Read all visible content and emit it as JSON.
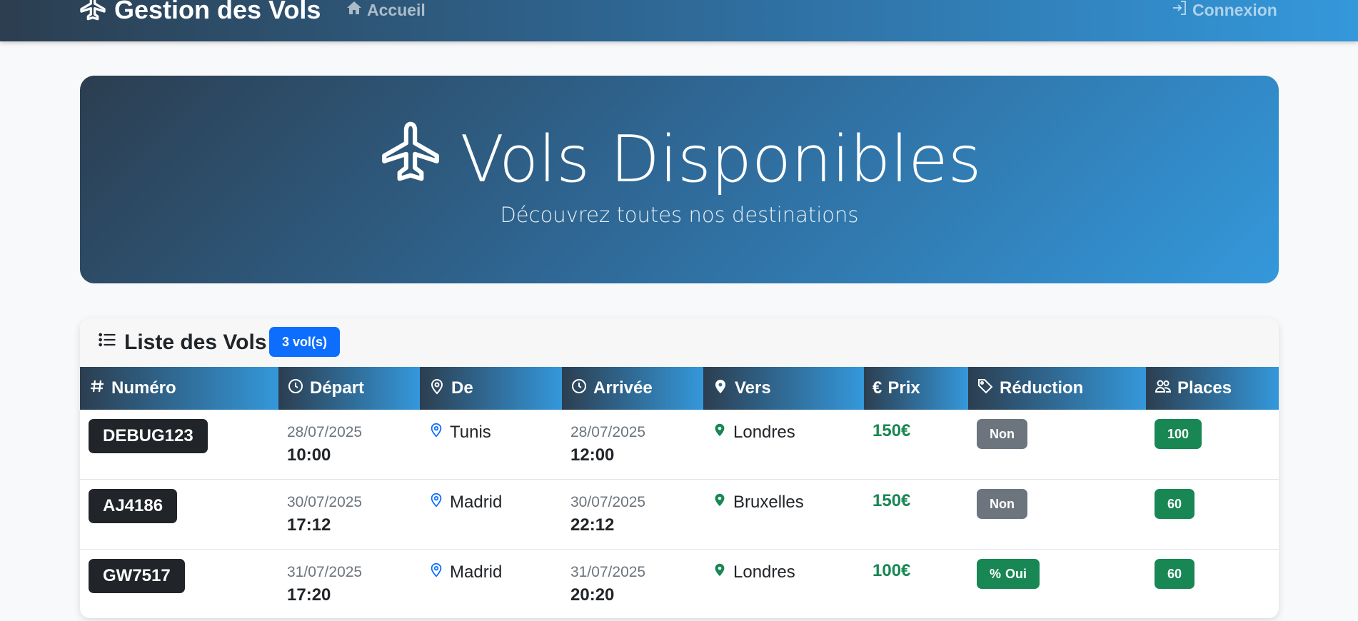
{
  "navbar": {
    "brand": "Gestion des Vols",
    "home_label": "Accueil",
    "login_label": "Connexion"
  },
  "hero": {
    "title": "Vols Disponibles",
    "subtitle": "Découvrez toutes nos destinations"
  },
  "list": {
    "title": "Liste des Vols",
    "count_badge": "3 vol(s)",
    "columns": [
      "Numéro",
      "Départ",
      "De",
      "Arrivée",
      "Vers",
      "Prix",
      "Réduction",
      "Places"
    ],
    "column_icons": [
      "hash-icon",
      "clock-icon",
      "map-pin-outline-icon",
      "clock-icon",
      "map-pin-filled-icon",
      "euro-icon",
      "tag-icon",
      "people-icon"
    ],
    "rows": [
      {
        "numero": "DEBUG123",
        "depart_date": "28/07/2025",
        "depart_time": "10:00",
        "de": "Tunis",
        "arrivee_date": "28/07/2025",
        "arrivee_time": "12:00",
        "vers": "Londres",
        "prix": "150€",
        "reduction": "Non",
        "places": "100"
      },
      {
        "numero": "AJ4186",
        "depart_date": "30/07/2025",
        "depart_time": "17:12",
        "de": "Madrid",
        "arrivee_date": "30/07/2025",
        "arrivee_time": "22:12",
        "vers": "Bruxelles",
        "prix": "150€",
        "reduction": "Non",
        "places": "60"
      },
      {
        "numero": "GW7517",
        "depart_date": "31/07/2025",
        "depart_time": "17:20",
        "de": "Madrid",
        "arrivee_date": "31/07/2025",
        "arrivee_time": "20:20",
        "vers": "Londres",
        "prix": "100€",
        "reduction": "Oui",
        "places": "60"
      }
    ]
  },
  "colors": {
    "primary_dark": "#2c3e50",
    "primary_light": "#3498db",
    "badge_blue": "#0d6efd",
    "success": "#198754",
    "secondary": "#6c757d",
    "pin_blue": "#0d6efd"
  }
}
